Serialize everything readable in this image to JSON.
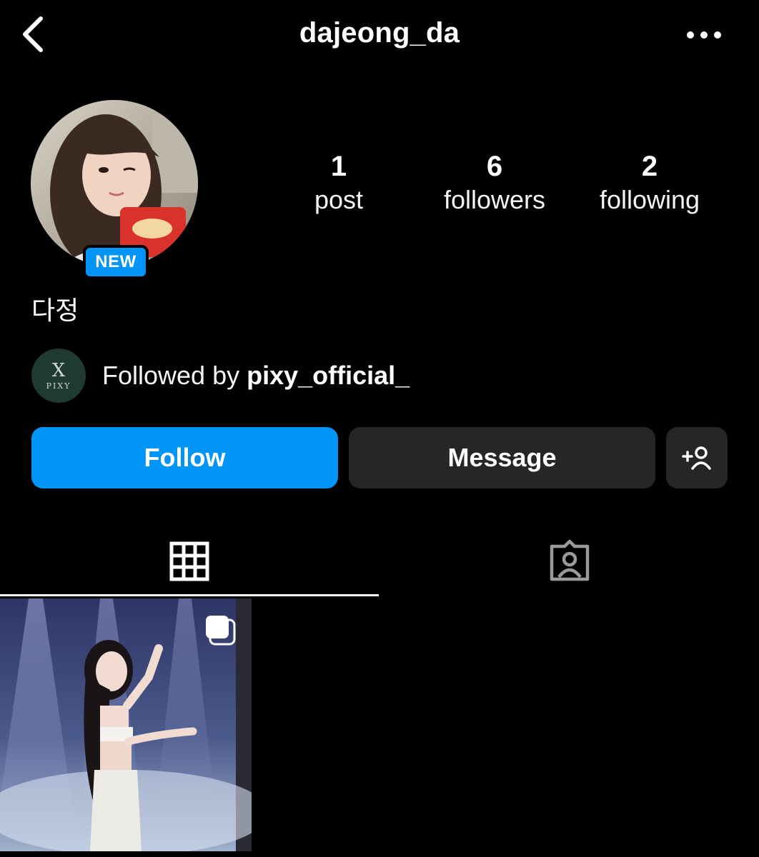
{
  "header": {
    "username": "dajeong_da"
  },
  "profile": {
    "badge": "NEW",
    "display_name": "다정"
  },
  "stats": [
    {
      "value": "1",
      "label": "post"
    },
    {
      "value": "6",
      "label": "followers"
    },
    {
      "value": "2",
      "label": "following"
    }
  ],
  "mutual": {
    "prefix": "Followed by ",
    "username": "pixy_official_",
    "avatar_text": "PIXY",
    "avatar_glyph": "X"
  },
  "actions": {
    "follow_label": "Follow",
    "message_label": "Message"
  },
  "tabs": [
    {
      "icon": "grid-icon",
      "active": true
    },
    {
      "icon": "tagged-icon",
      "active": false
    }
  ],
  "posts": [
    {
      "type": "carousel"
    }
  ],
  "colors": {
    "background": "#000000",
    "accent": "#0095f6",
    "button_secondary": "#262626",
    "text": "#ffffff"
  }
}
